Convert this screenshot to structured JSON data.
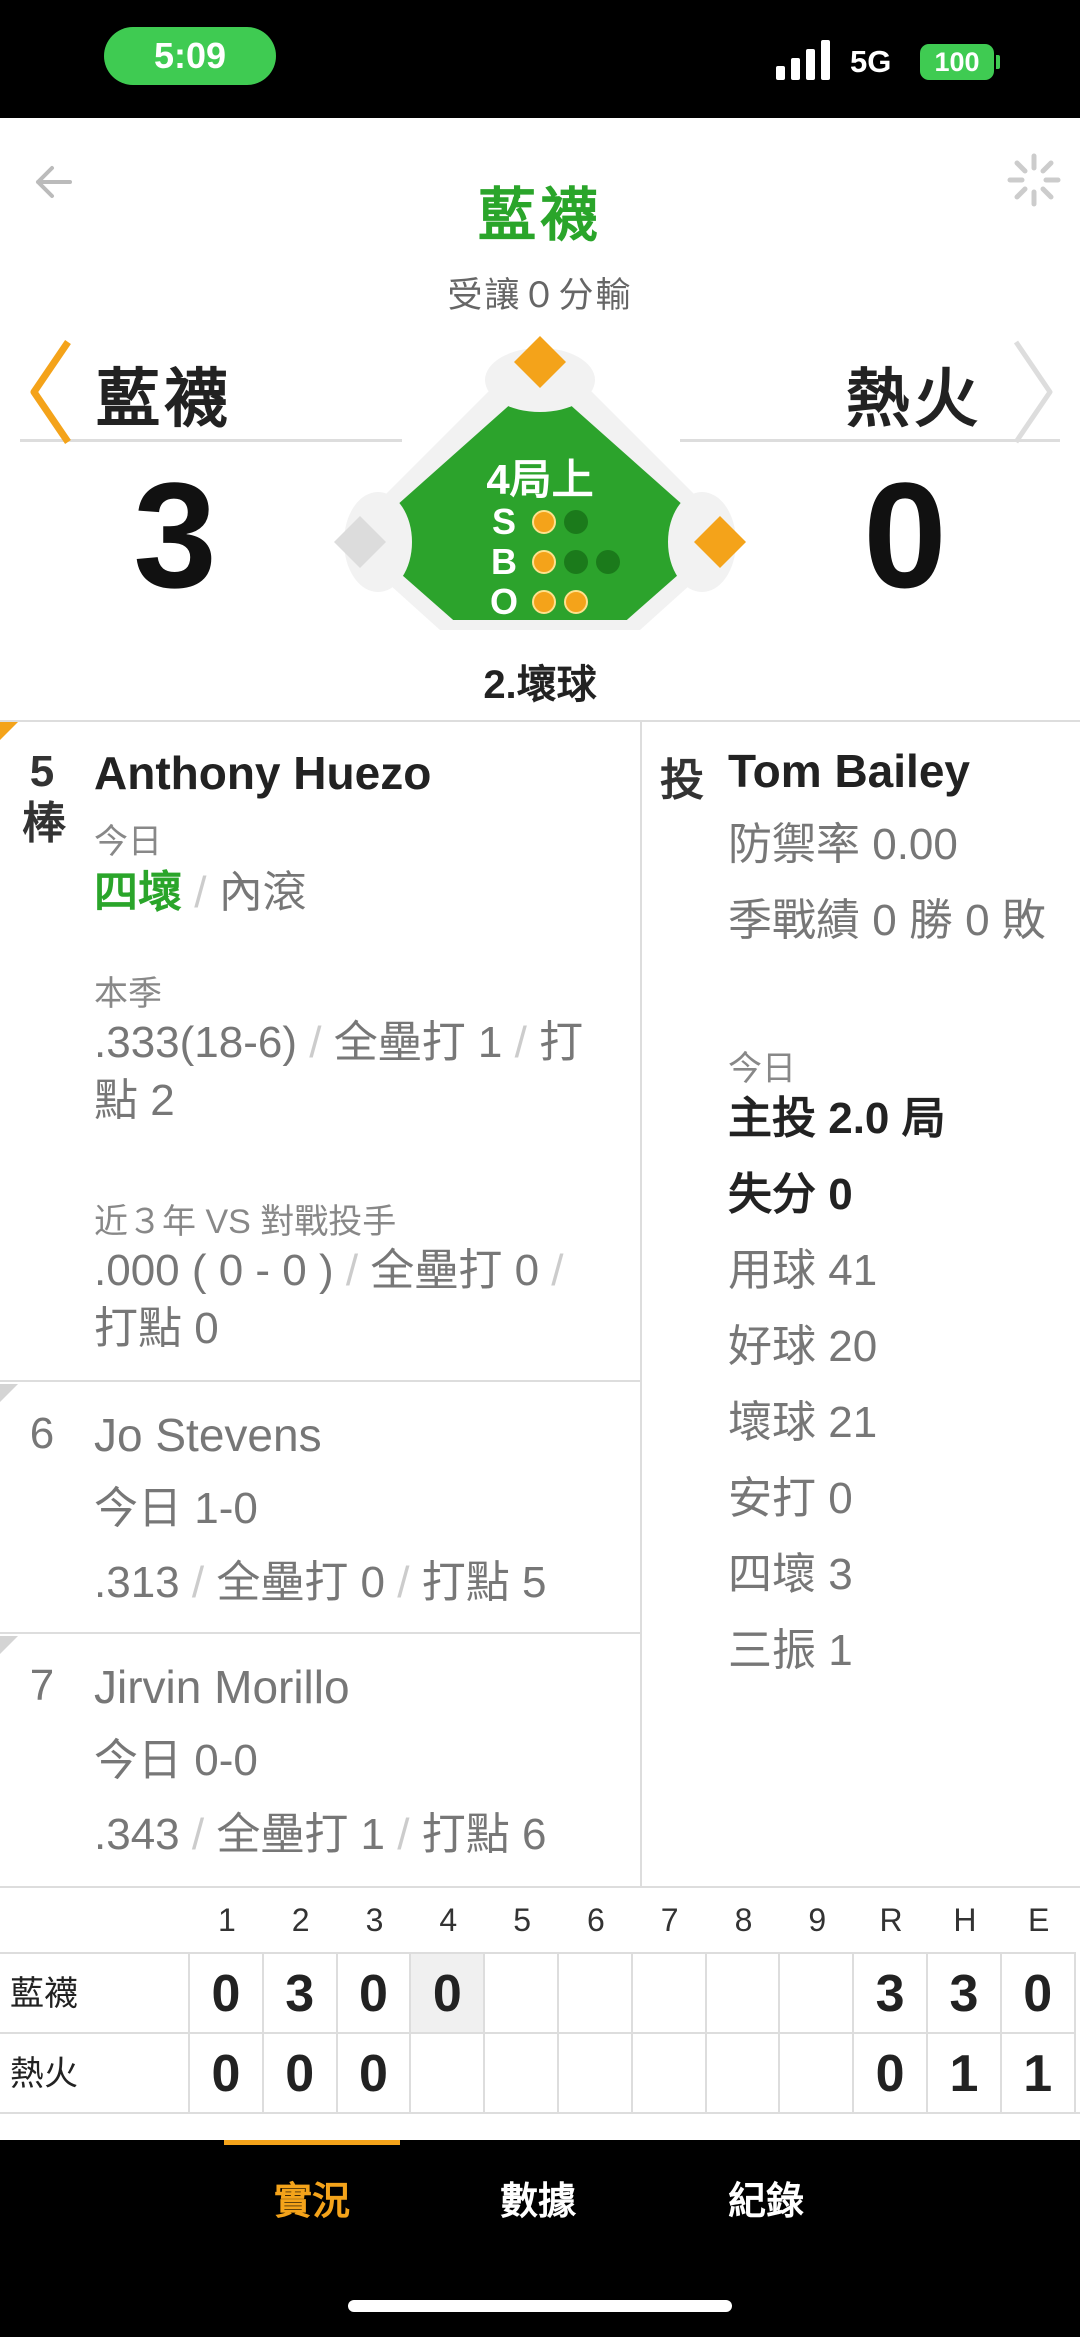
{
  "status_bar": {
    "time": "5:09",
    "network": "5G",
    "battery": "100"
  },
  "header": {
    "title": "藍襪",
    "subtitle": "受讓０分輸"
  },
  "scoreboard": {
    "away_team": "藍襪",
    "home_team": "熱火",
    "away_score": "3",
    "home_score": "0",
    "inning": "4局上",
    "count_labels": [
      "S",
      "B",
      "O"
    ],
    "strikes": 1,
    "balls": 1,
    "outs": 2,
    "last_call": "2.壞球"
  },
  "batters": [
    {
      "order": "5",
      "order_suffix": "棒",
      "name": "Anthony Huezo",
      "today_label": "今日",
      "today_result": "四壞",
      "today_result2": "內滾",
      "season_label": "本季",
      "season_avg": ".333(18-6)",
      "season_hr": "全壘打 1",
      "season_rbi": "打點 2",
      "vs_label": "近３年 VS 對戰投手",
      "vs_avg": ".000 ( 0 - 0 )",
      "vs_hr": "全壘打 0",
      "vs_rbi": "打點 0"
    },
    {
      "order": "6",
      "name": "Jo Stevens",
      "today": "今日 1-0",
      "avg": ".313",
      "hr": "全壘打 0",
      "rbi": "打點 5"
    },
    {
      "order": "7",
      "name": "Jirvin Morillo",
      "today": "今日 0-0",
      "avg": ".343",
      "hr": "全壘打 1",
      "rbi": "打點 6"
    }
  ],
  "pitcher": {
    "tag": "投",
    "name": "Tom Bailey",
    "era": "防禦率 0.00",
    "record": "季戰績 0 勝 0 敗",
    "today_label": "今日",
    "ip": "主投 2.0 局",
    "runs": "失分 0",
    "pitches": "用球 41",
    "strikes": "好球 20",
    "balls": "壞球 21",
    "hits": "安打 0",
    "walks": "四壞 3",
    "strikeouts": "三振 1"
  },
  "linescore": {
    "headers": [
      "1",
      "2",
      "3",
      "4",
      "5",
      "6",
      "7",
      "8",
      "9",
      "R",
      "H",
      "E"
    ],
    "rows": [
      {
        "team": "藍襪",
        "innings": [
          "0",
          "3",
          "0",
          "0",
          "",
          "",
          "",
          "",
          ""
        ],
        "r": "3",
        "h": "3",
        "e": "0"
      },
      {
        "team": "熱火",
        "innings": [
          "0",
          "0",
          "0",
          "",
          "",
          "",
          "",
          "",
          ""
        ],
        "r": "0",
        "h": "1",
        "e": "1"
      }
    ]
  },
  "tabs": [
    "實況",
    "數據",
    "紀錄"
  ],
  "colors": {
    "accent": "#f4a31a",
    "green": "#2aa52a",
    "field": "#2ca32c"
  }
}
